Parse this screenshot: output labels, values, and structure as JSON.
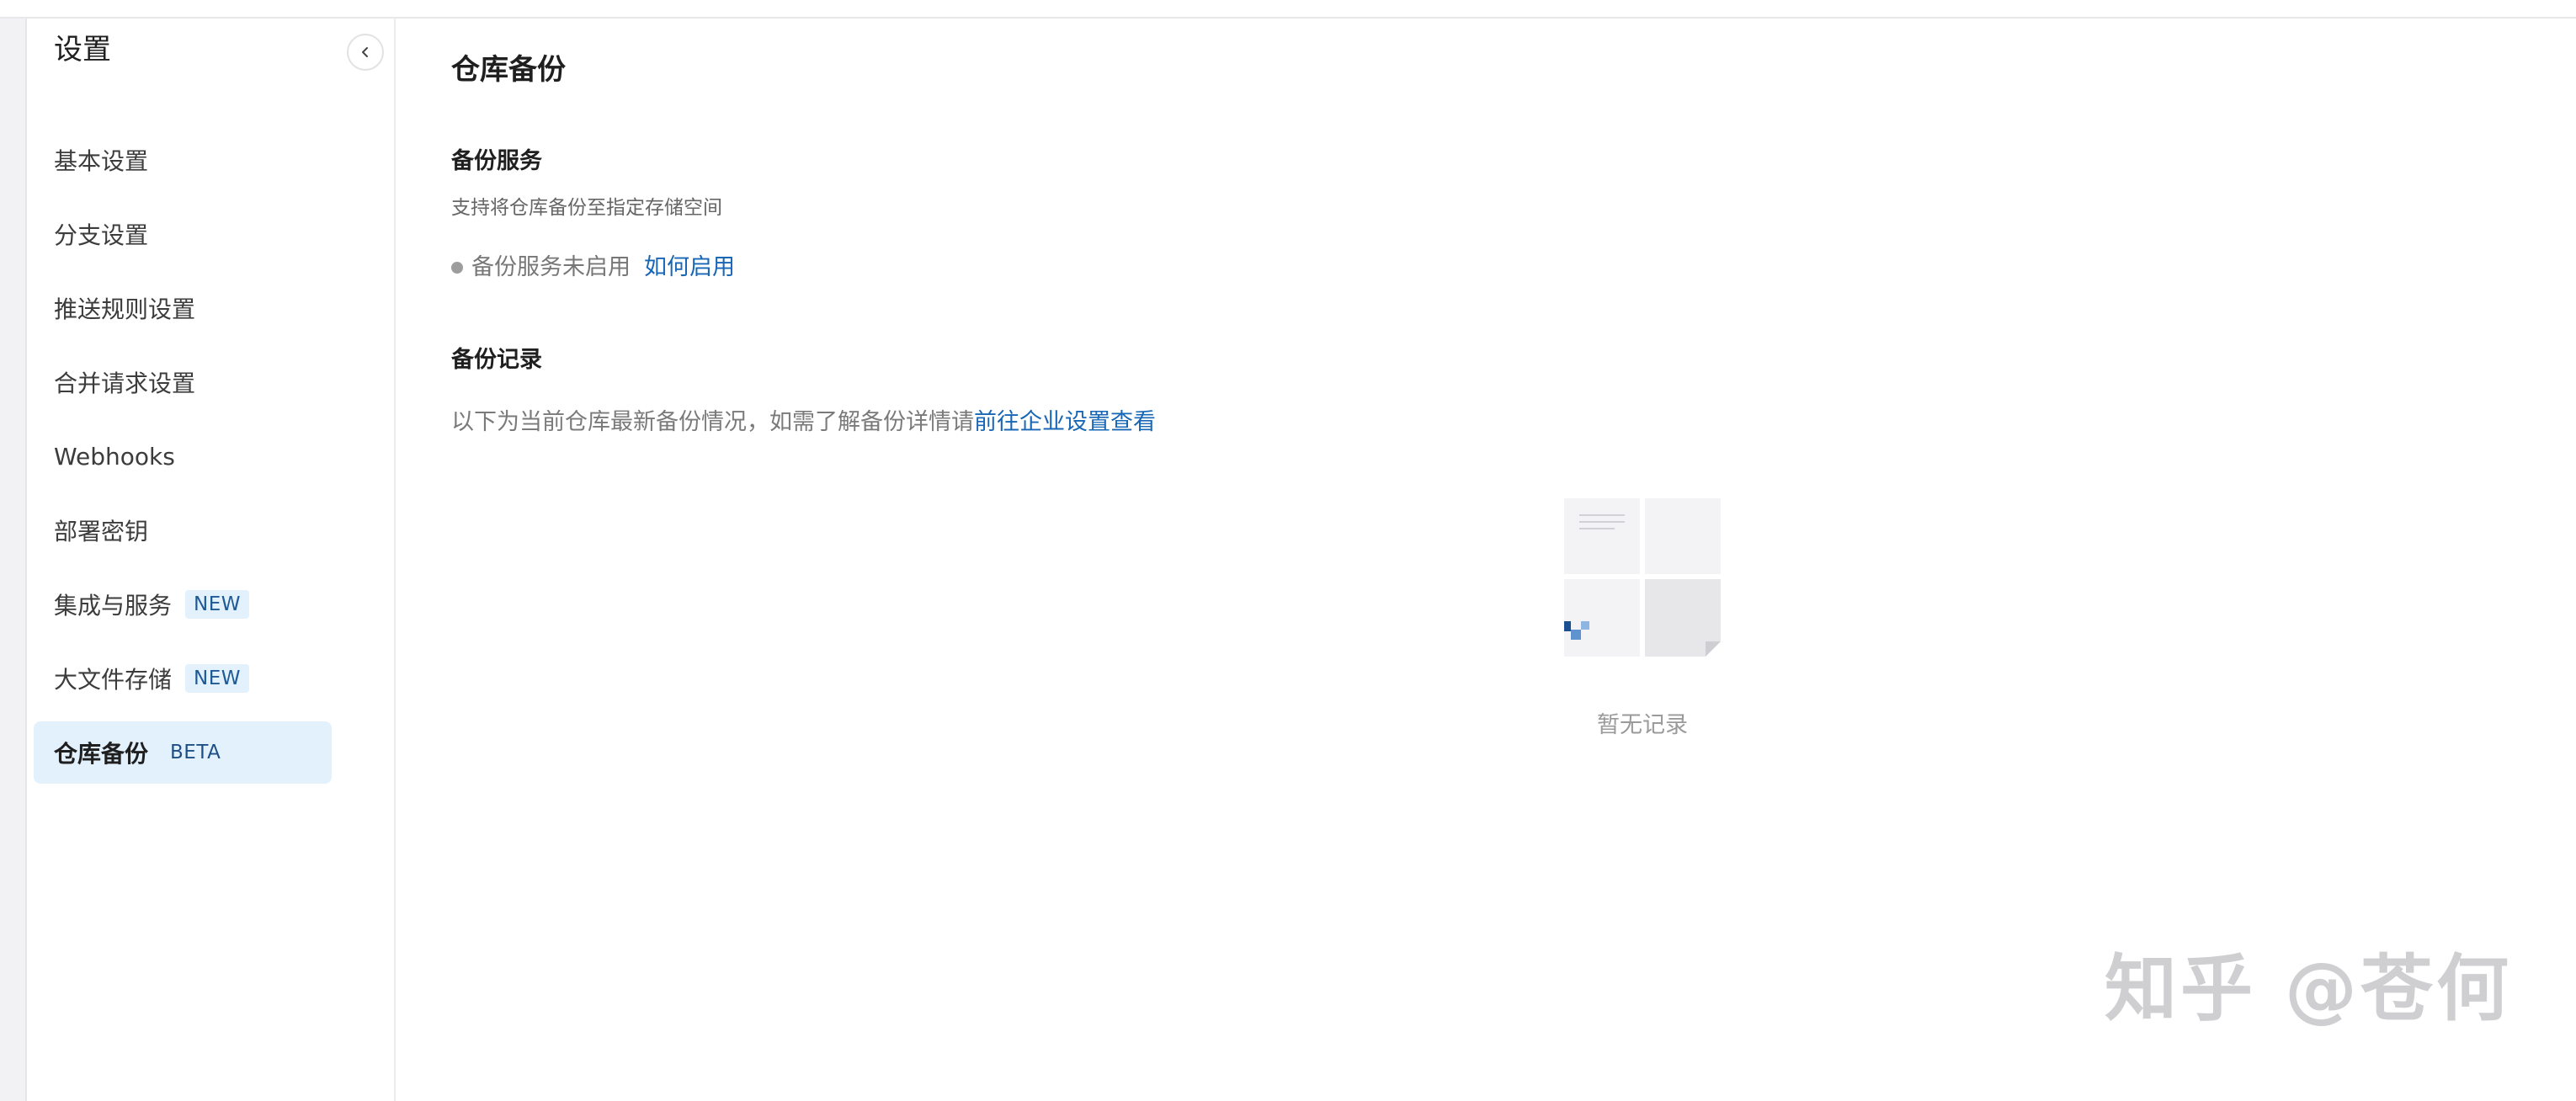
{
  "sidebar": {
    "title": "设置",
    "items": [
      {
        "label": "基本设置",
        "badge": ""
      },
      {
        "label": "分支设置",
        "badge": ""
      },
      {
        "label": "推送规则设置",
        "badge": ""
      },
      {
        "label": "合并请求设置",
        "badge": ""
      },
      {
        "label": "Webhooks",
        "badge": ""
      },
      {
        "label": "部署密钥",
        "badge": ""
      },
      {
        "label": "集成与服务",
        "badge": "NEW"
      },
      {
        "label": "大文件存储",
        "badge": "NEW"
      },
      {
        "label": "仓库备份",
        "badge": "BETA"
      }
    ],
    "active_index": 8,
    "collapse_icon": "chevron-left-icon"
  },
  "main": {
    "title": "仓库备份",
    "backup_service": {
      "title": "备份服务",
      "description": "支持将仓库备份至指定存储空间",
      "status_text": "备份服务未启用",
      "status_link": "如何启用"
    },
    "backup_records": {
      "title": "备份记录",
      "description": "以下为当前仓库最新备份情况，如需了解备份详情请",
      "description_link": "前往企业设置查看",
      "empty_text": "暂无记录",
      "empty_icon": "empty-records-illustration"
    }
  },
  "watermark": "知乎 @苍何",
  "colors": {
    "accent": "#1867b6",
    "active_bg": "#e3f1fd",
    "badge_text": "#1d5a96",
    "status_dot": "#9d9d9d"
  }
}
